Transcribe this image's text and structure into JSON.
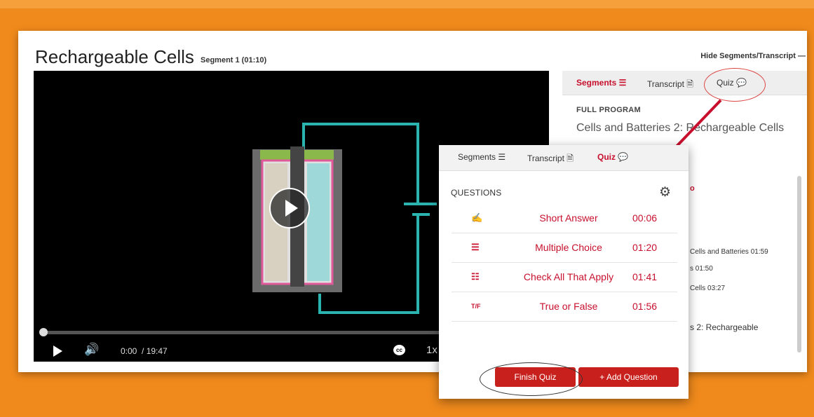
{
  "page": {
    "title": "Rechargeable Cells",
    "segment_label": "Segment 1 (01:10)",
    "hide_link": "Hide Segments/Transcript —"
  },
  "player": {
    "current_time": "0:00",
    "duration": "/ 19:47",
    "cc_label": "cc",
    "speed": "1x",
    "progress_fraction": 0
  },
  "sidebar": {
    "tabs": [
      "Segments ☰",
      "Transcript 🗎",
      "Quiz 💬"
    ],
    "active_tab": "Segments",
    "full_program_label": "FULL PROGRAM",
    "program_name": "Cells and Batteries 2: Rechargeable Cells",
    "partial_rows": [
      "o",
      "Cells and Batteries 01:59",
      "s 01:50",
      "Cells 03:27",
      "s 2: Rechargeable"
    ]
  },
  "quiz": {
    "tabs": [
      "Segments ☰",
      "Transcript 🗎",
      "Quiz 💬"
    ],
    "active_tab": "Quiz",
    "header": "QUESTIONS",
    "questions": [
      {
        "icon": "short-answer-icon",
        "icon_glyph": "✍",
        "label": "Short Answer",
        "time": "00:06"
      },
      {
        "icon": "list-icon",
        "icon_glyph": "☰",
        "label": "Multiple Choice",
        "time": "01:20"
      },
      {
        "icon": "checklist-icon",
        "icon_glyph": "☷",
        "label": "Check All That Apply",
        "time": "01:41"
      },
      {
        "icon": "true-false-icon",
        "icon_glyph": "T/F",
        "label": "True or False",
        "time": "01:56"
      }
    ],
    "finish_button": "Finish Quiz",
    "add_button": "+ Add Question"
  },
  "colors": {
    "accent": "#c8102e",
    "background": "#f08a1c",
    "video_circuit": "#2bb3b0"
  }
}
